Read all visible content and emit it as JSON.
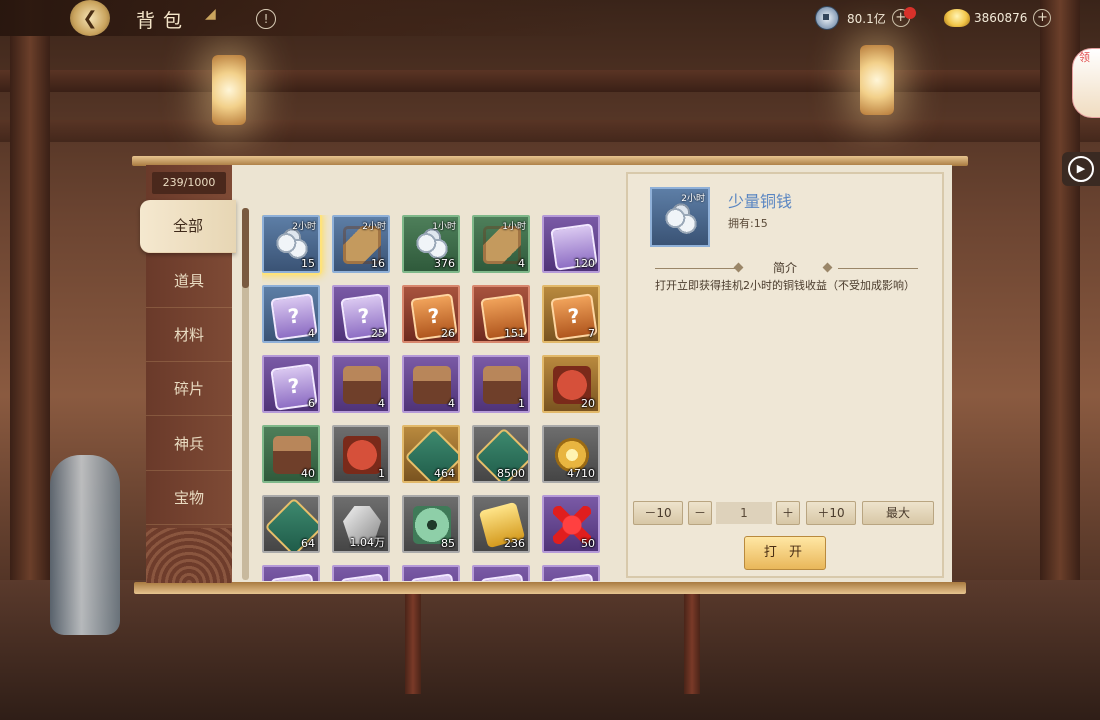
{
  "header": {
    "title": "背包",
    "back_icon": "back-arrow-icon",
    "info_icon": "!"
  },
  "currency": {
    "silver_value": "80.1亿",
    "gold_value": "3860876",
    "plus": "+"
  },
  "side_tab": {
    "label": "领"
  },
  "capacity": "239/1000",
  "nav": {
    "items": [
      {
        "label": "全部",
        "active": true
      },
      {
        "label": "道具",
        "active": false
      },
      {
        "label": "材料",
        "active": false
      },
      {
        "label": "碎片",
        "active": false
      },
      {
        "label": "神兵",
        "active": false
      },
      {
        "label": "宝物",
        "active": false
      }
    ]
  },
  "grid": {
    "items": [
      {
        "icon": "coins",
        "rarity": "blue",
        "badge": "2小时",
        "count": "15",
        "selected": true
      },
      {
        "icon": "scroll",
        "rarity": "blue",
        "badge": "2小时",
        "count": "16"
      },
      {
        "icon": "coins",
        "rarity": "green",
        "badge": "1小时",
        "count": "376"
      },
      {
        "icon": "scroll",
        "rarity": "green",
        "badge": "1小时",
        "count": "4"
      },
      {
        "icon": "card",
        "rarity": "purple",
        "badge": "",
        "count": "120"
      },
      {
        "icon": "card-q",
        "rarity": "blue",
        "badge": "",
        "count": "4"
      },
      {
        "icon": "card-q",
        "rarity": "purple",
        "badge": "",
        "count": "25"
      },
      {
        "icon": "card-orange-q",
        "rarity": "red",
        "badge": "",
        "count": "26"
      },
      {
        "icon": "card-orange",
        "rarity": "red",
        "badge": "",
        "count": "151"
      },
      {
        "icon": "card-orange-q",
        "rarity": "gold",
        "badge": "",
        "count": "7"
      },
      {
        "icon": "card-q",
        "rarity": "purple",
        "badge": "",
        "count": "6"
      },
      {
        "icon": "chest",
        "rarity": "purple",
        "badge": "",
        "count": "4"
      },
      {
        "icon": "chest",
        "rarity": "purple",
        "badge": "",
        "count": "4"
      },
      {
        "icon": "chest",
        "rarity": "purple",
        "badge": "",
        "count": "1"
      },
      {
        "icon": "bag",
        "rarity": "gold",
        "badge": "",
        "count": "20"
      },
      {
        "icon": "chest",
        "rarity": "green",
        "badge": "",
        "count": "40"
      },
      {
        "icon": "bag",
        "rarity": "gray",
        "badge": "",
        "count": "1"
      },
      {
        "icon": "token",
        "rarity": "gold",
        "badge": "",
        "count": "464"
      },
      {
        "icon": "token",
        "rarity": "gray",
        "badge": "",
        "count": "8500"
      },
      {
        "icon": "gold-coin",
        "rarity": "gray",
        "badge": "",
        "count": "4710"
      },
      {
        "icon": "token",
        "rarity": "gray",
        "badge": "",
        "count": "64"
      },
      {
        "icon": "silver",
        "rarity": "gray",
        "badge": "",
        "count": "1.04万"
      },
      {
        "icon": "jade",
        "rarity": "gray",
        "badge": "",
        "count": "85"
      },
      {
        "icon": "ticket",
        "rarity": "gray",
        "badge": "",
        "count": "236"
      },
      {
        "icon": "knot",
        "rarity": "purple",
        "badge": "",
        "count": "50"
      },
      {
        "icon": "card",
        "rarity": "purple",
        "badge": "",
        "count": ""
      },
      {
        "icon": "card",
        "rarity": "purple",
        "badge": "",
        "count": ""
      },
      {
        "icon": "card",
        "rarity": "purple",
        "badge": "",
        "count": ""
      },
      {
        "icon": "card",
        "rarity": "purple",
        "badge": "",
        "count": ""
      },
      {
        "icon": "card",
        "rarity": "purple",
        "badge": "",
        "count": ""
      }
    ]
  },
  "detail": {
    "badge": "2小时",
    "name": "少量铜钱",
    "owned": "拥有:15",
    "section_title": "简介",
    "description": "打开立即获得挂机2小时的铜钱收益（不受加成影响）"
  },
  "quantity": {
    "minus10": "－10",
    "minus": "－",
    "value": "1",
    "plus": "＋",
    "plus10": "＋10",
    "max": "最大"
  },
  "open_button": "打 开",
  "colors": {
    "accent_name": "#5a86c2",
    "button_gold": "#e9b75a",
    "nav_bg": "#6a3a2a"
  }
}
